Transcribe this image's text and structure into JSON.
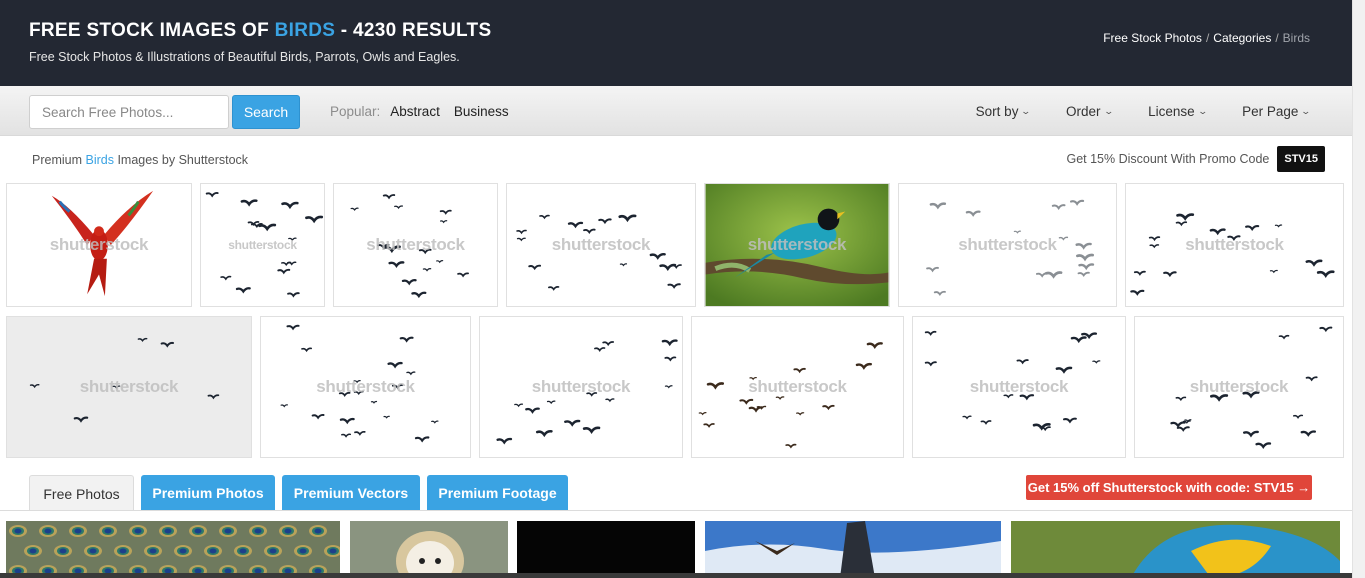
{
  "header": {
    "title_prefix": "FREE STOCK IMAGES OF ",
    "title_accent": "BIRDS",
    "title_suffix": " - 4230 RESULTS",
    "subtitle": "Free Stock Photos & Illustrations of Beautiful Birds, Parrots, Owls and Eagles.",
    "breadcrumbs": [
      "Free Stock Photos",
      "Categories",
      "Birds"
    ],
    "breadcrumb_sep": "/"
  },
  "toolbar": {
    "search_placeholder": "Search Free Photos...",
    "search_button": "Search",
    "popular_label": "Popular:",
    "popular_links": [
      "Abstract",
      "Business"
    ],
    "dropdowns": [
      "Sort by",
      "Order",
      "License",
      "Per Page"
    ]
  },
  "premium": {
    "prefix": "Premium ",
    "accent": "Birds",
    "suffix": " Images by Shutterstock",
    "promo_text": "Get 15% Discount With Promo Code",
    "promo_code": "STV15",
    "watermark": "shutterstock"
  },
  "tabs": [
    "Free Photos",
    "Premium Photos",
    "Premium Vectors",
    "Premium Footage"
  ],
  "promo_button": "Get 15% off Shutterstock with code: STV15 →",
  "colors": {
    "accent": "#3aa3e3",
    "header_bg": "#232833",
    "promo_red": "#e0463a"
  },
  "icons": [
    "chevron-down-icon"
  ]
}
